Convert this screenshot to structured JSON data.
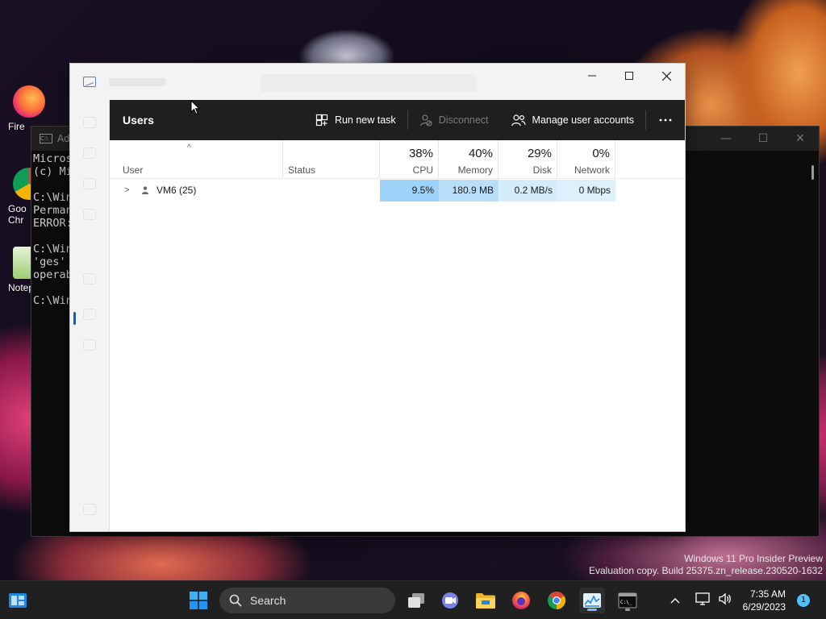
{
  "desktop": {
    "icons": [
      {
        "label": "Fire",
        "color": "#ff7139"
      },
      {
        "label": "Goo Chr",
        "color": "#1a73e8"
      },
      {
        "label": "Notep",
        "color": "#6aa84f"
      }
    ]
  },
  "cmd": {
    "title": "Ad",
    "lines": [
      "Micros",
      "(c) Mi",
      "",
      "C:\\Win",
      "Perman",
      "ERROR:",
      "",
      "C:\\Win",
      "'ges'",
      "operab",
      "",
      "C:\\Win"
    ]
  },
  "task_manager": {
    "heading": "Users",
    "toolbar": {
      "run_new_task": "Run new task",
      "disconnect": "Disconnect",
      "manage_user_accounts": "Manage user accounts",
      "more": "⋯"
    },
    "columns": {
      "user": "User",
      "status": "Status",
      "cpu": {
        "pct": "38%",
        "label": "CPU"
      },
      "memory": {
        "pct": "40%",
        "label": "Memory"
      },
      "disk": {
        "pct": "29%",
        "label": "Disk"
      },
      "network": {
        "pct": "0%",
        "label": "Network"
      }
    },
    "rows": [
      {
        "user": "VM6 (25)",
        "status": "",
        "cpu": "9.5%",
        "memory": "180.9 MB",
        "disk": "0.2 MB/s",
        "network": "0 Mbps"
      }
    ],
    "colors": {
      "cpu_cell": "#9fd2f8",
      "memory_cell": "#b8def9",
      "disk_cell": "#d5ecfb",
      "network_cell": "#def0fc"
    }
  },
  "taskbar": {
    "search_label": "Search",
    "time": "7:35 AM",
    "date": "6/29/2023",
    "notifications": "1"
  },
  "watermark": {
    "line1": "Windows 11 Pro Insider Preview",
    "line2": "Evaluation copy. Build 25375.zn_release.230520-1632"
  }
}
